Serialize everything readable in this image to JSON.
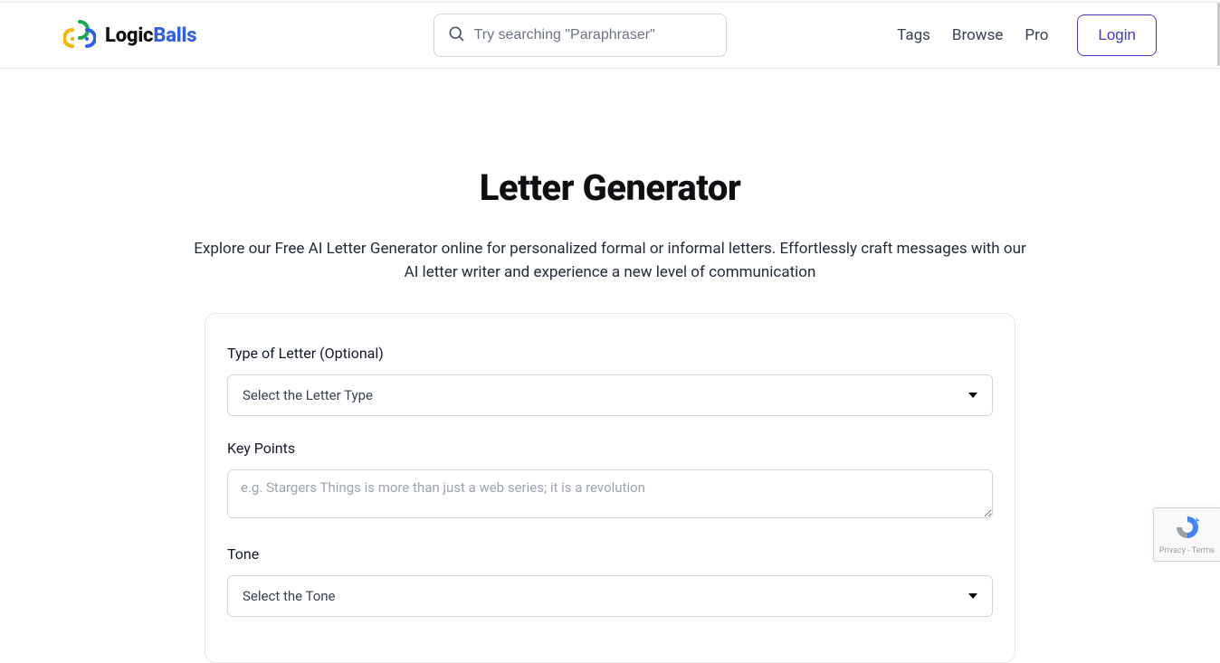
{
  "brand": {
    "part1": "Logic",
    "part2": "Balls"
  },
  "search": {
    "placeholder": "Try searching \"Paraphraser\""
  },
  "nav": {
    "tags": "Tags",
    "browse": "Browse",
    "pro": "Pro",
    "login": "Login"
  },
  "page": {
    "title": "Letter Generator",
    "subtitle": "Explore our Free AI Letter Generator online for personalized formal or informal letters. Effortlessly craft messages with our AI letter writer and experience a new level of communication"
  },
  "form": {
    "type_label": "Type of Letter (Optional)",
    "type_placeholder": "Select the Letter Type",
    "keypoints_label": "Key Points",
    "keypoints_placeholder": "e.g. Stargers Things is more than just a web series; it is a revolution",
    "tone_label": "Tone",
    "tone_placeholder": "Select the Tone"
  },
  "recaptcha": {
    "privacy": "Privacy",
    "terms": "Terms",
    "sep": " - "
  }
}
